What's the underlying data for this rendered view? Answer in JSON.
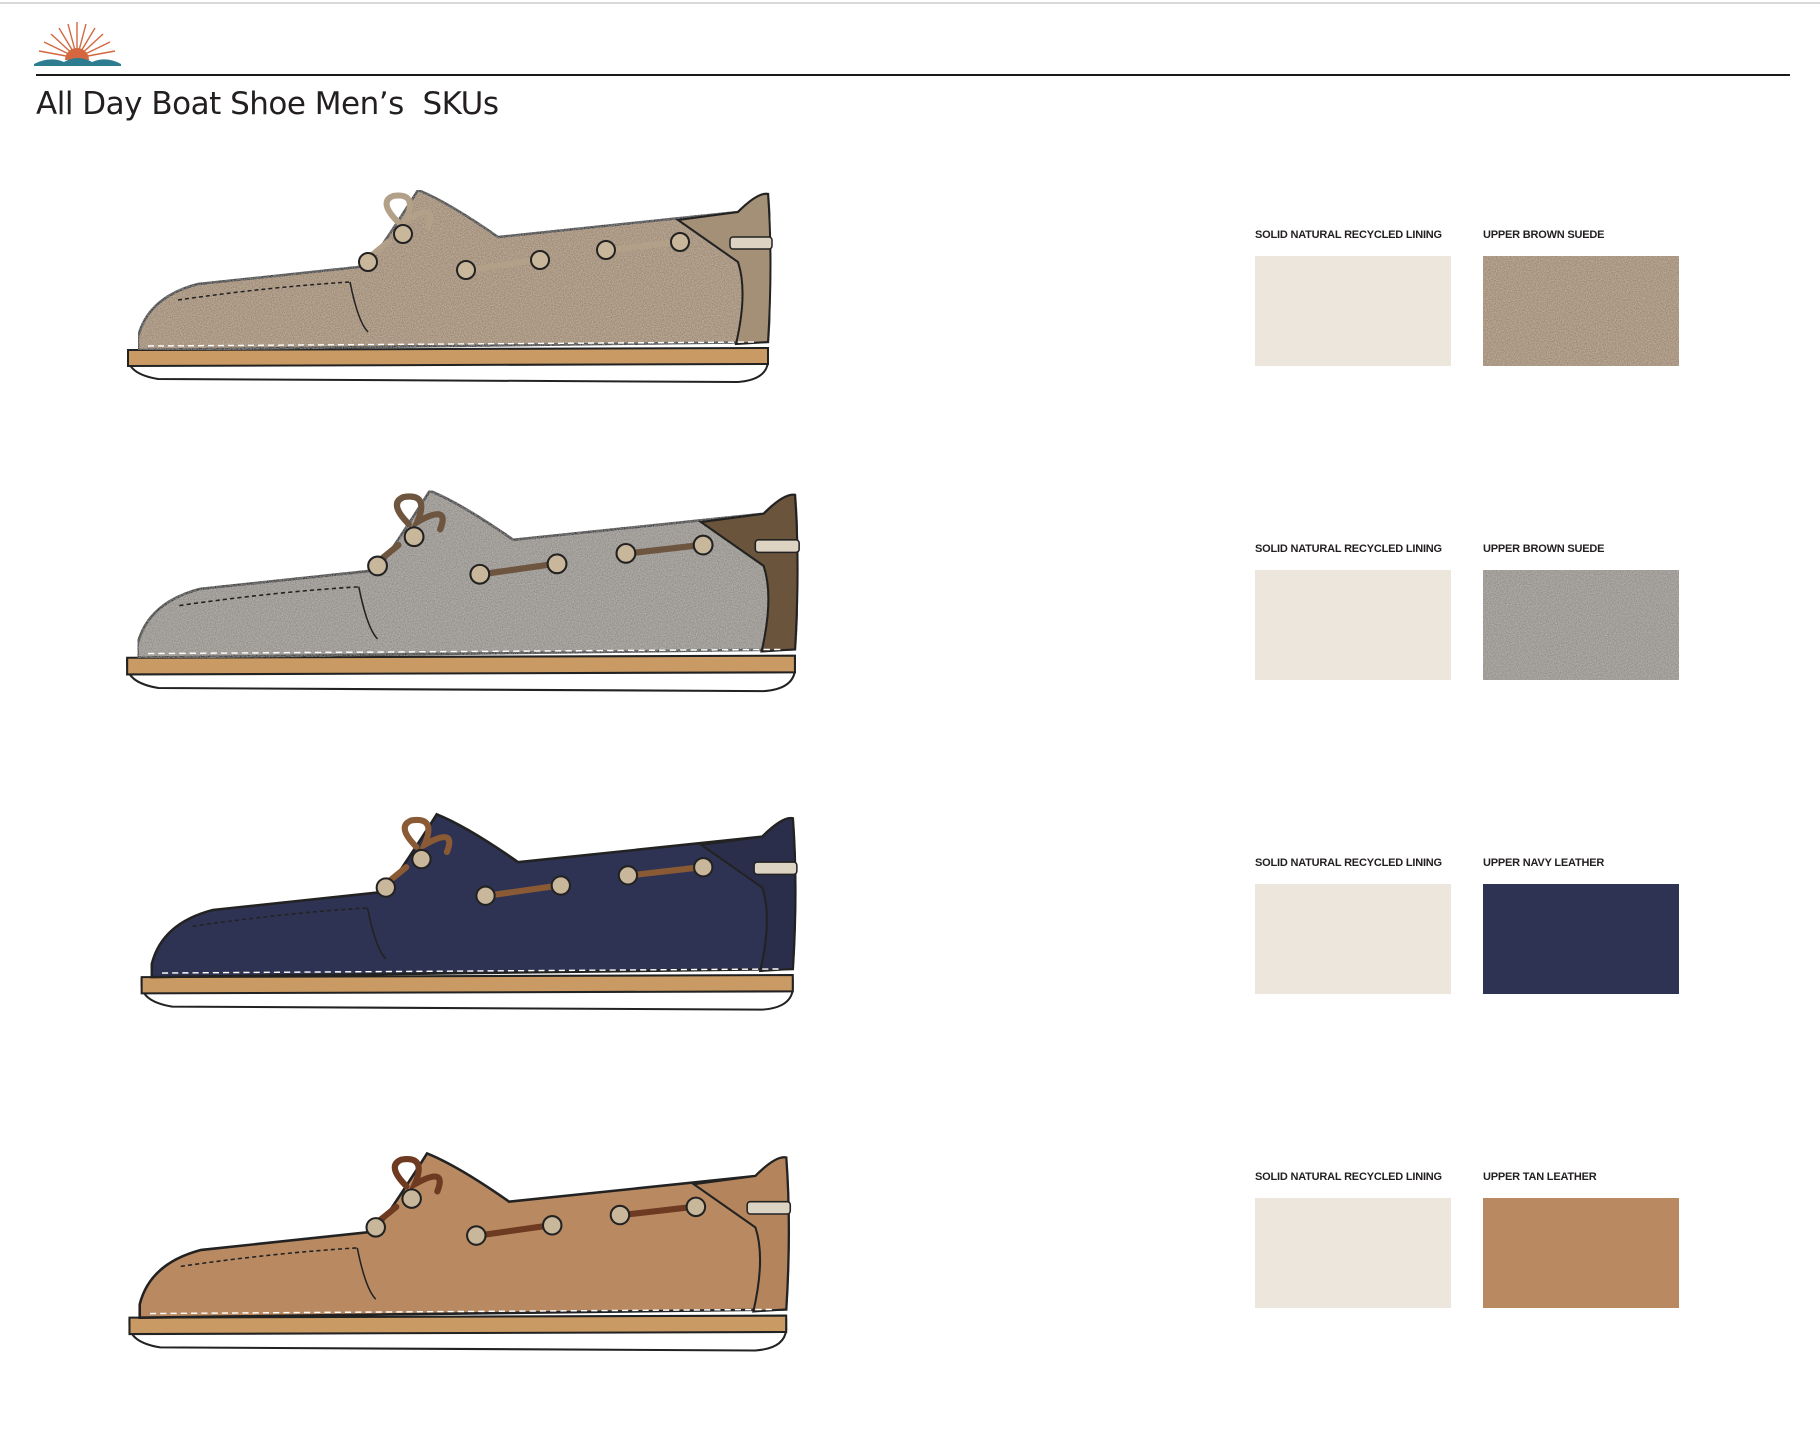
{
  "header": {
    "title": "All Day Boat Shoe Men’s  SKUs",
    "logo_icon": "sunrise-logo-icon",
    "logo_colors": {
      "sun": "#d4673f",
      "waves": "#2d7c8f"
    }
  },
  "skus": [
    {
      "shoe_colors": {
        "upper": "#9c8468",
        "heel": "#a39076",
        "lace": "#b3a088"
      },
      "swatches": [
        {
          "label": "SOLID NATURAL RECYCLED LINING",
          "color": "#ece6dc",
          "texture": "solid"
        },
        {
          "label": "UPPER BROWN SUEDE",
          "color": "#9c8468",
          "texture": "suede"
        }
      ]
    },
    {
      "shoe_colors": {
        "upper": "#8f8a84",
        "heel": "#6b543c",
        "lace": "#6e5540"
      },
      "swatches": [
        {
          "label": "SOLID NATURAL RECYCLED LINING",
          "color": "#ece6dc",
          "texture": "solid"
        },
        {
          "label": "UPPER BROWN SUEDE",
          "color": "#8f8a84",
          "texture": "suede"
        }
      ]
    },
    {
      "shoe_colors": {
        "upper": "#2e3353",
        "heel": "#2a2e4a",
        "lace": "#8a5a35"
      },
      "swatches": [
        {
          "label": "SOLID NATURAL RECYCLED LINING",
          "color": "#ece6dc",
          "texture": "solid"
        },
        {
          "label": "UPPER NAVY LEATHER",
          "color": "#2e3353",
          "texture": "solid"
        }
      ]
    },
    {
      "shoe_colors": {
        "upper": "#b98a62",
        "heel": "#b4845c",
        "lace": "#6e3a22"
      },
      "swatches": [
        {
          "label": "SOLID NATURAL RECYCLED LINING",
          "color": "#ece6dc",
          "texture": "solid"
        },
        {
          "label": "UPPER TAN LEATHER",
          "color": "#b98a62",
          "texture": "solid"
        }
      ]
    }
  ]
}
